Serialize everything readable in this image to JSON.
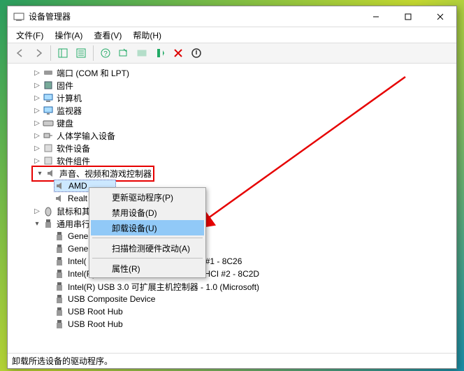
{
  "window": {
    "title": "设备管理器"
  },
  "menu": {
    "file": "文件(F)",
    "action": "操作(A)",
    "view": "查看(V)",
    "help": "帮助(H)"
  },
  "tree": {
    "ports": "端口 (COM 和 LPT)",
    "firmware": "固件",
    "computer": "计算机",
    "monitor": "监视器",
    "keyboard": "键盘",
    "hid": "人体学输入设备",
    "software_devices": "软件设备",
    "software_components": "软件组件",
    "sound_cat": "声音、视频和游戏控制器",
    "amd": "AMD",
    "realtek": "Realt",
    "mouse": "鼠标和其",
    "usb_cat": "通用串行",
    "gene1": "Gene",
    "gene2": "Gene",
    "intel1_a": "Intel(",
    "intel1_b": "#1 - 8C26",
    "intel2": "Intel(R) 8 Series/C220 Series USB EHCI #2 - 8C2D",
    "intel3": "Intel(R) USB 3.0 可扩展主机控制器 - 1.0 (Microsoft)",
    "usb_comp": "USB Composite Device",
    "usb_root1": "USB Root Hub",
    "usb_root2": "USB Root Hub"
  },
  "context_menu": {
    "update": "更新驱动程序(P)",
    "disable": "禁用设备(D)",
    "uninstall": "卸载设备(U)",
    "scan": "扫描检测硬件改动(A)",
    "properties": "属性(R)"
  },
  "statusbar": {
    "text": "卸载所选设备的驱动程序。"
  }
}
